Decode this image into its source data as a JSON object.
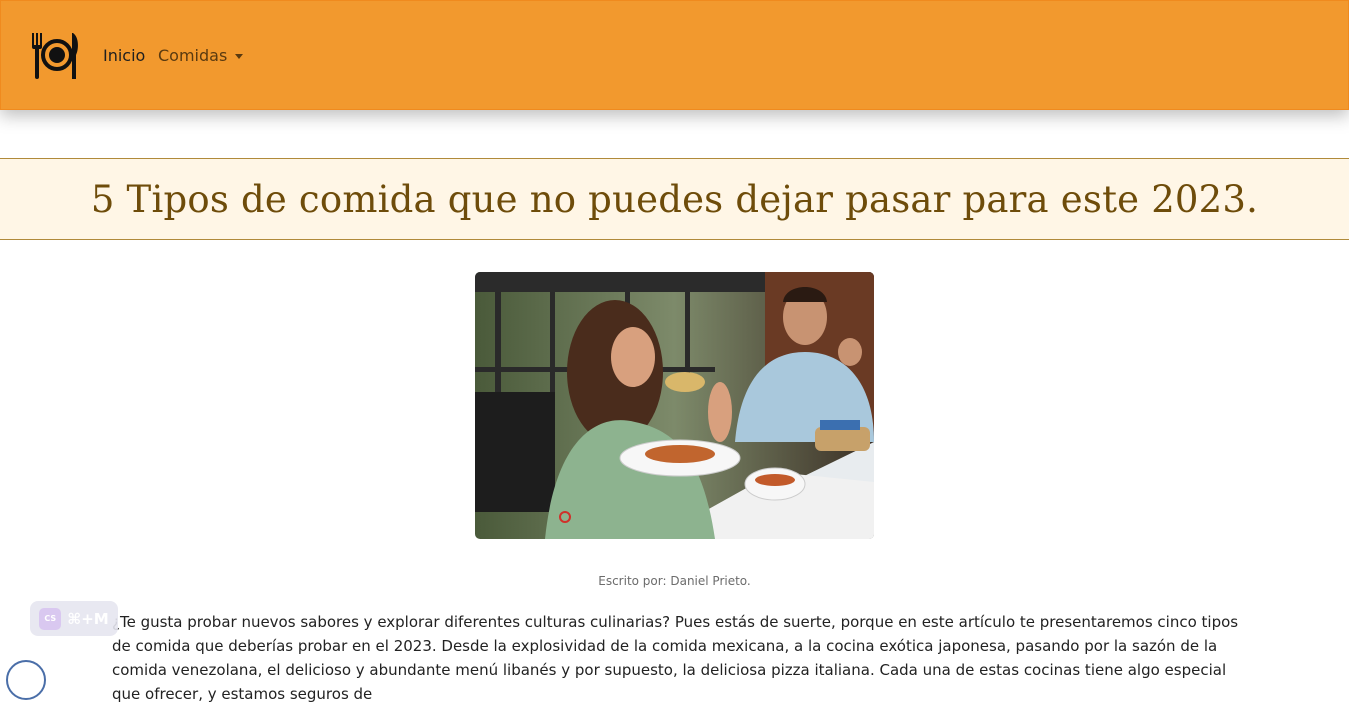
{
  "navbar": {
    "brand_icon": "plate-fork-knife-icon",
    "inicio_label": "Inicio",
    "comidas_label": "Comidas"
  },
  "article": {
    "title": "5 Tipos de comida que no puedes dejar pasar para este 2023.",
    "hero_image": "people-eating-mexican-food-photo",
    "byline": "Escrito por: Daniel Prieto.",
    "intro": "¿Te gusta probar nuevos sabores y explorar diferentes culturas culinarias? Pues estás de suerte, porque en este artículo te presentaremos cinco tipos de comida que deberías probar en el 2023. Desde la explosividad de la comida mexicana, a la cocina exótica japonesa, pasando por la sazón de la comida venezolana, el delicioso y abundante menú libanés y por supuesto, la deliciosa pizza italiana. Cada una de estas cocinas tiene algo especial que ofrecer, y estamos seguros de"
  },
  "overlay": {
    "shortcut_label": "⌘+M",
    "shortcut_badge": "CS"
  },
  "colors": {
    "navbar_bg": "#f2992e",
    "title_band_bg": "#fff6e6",
    "title_color": "#6e4c0a"
  }
}
